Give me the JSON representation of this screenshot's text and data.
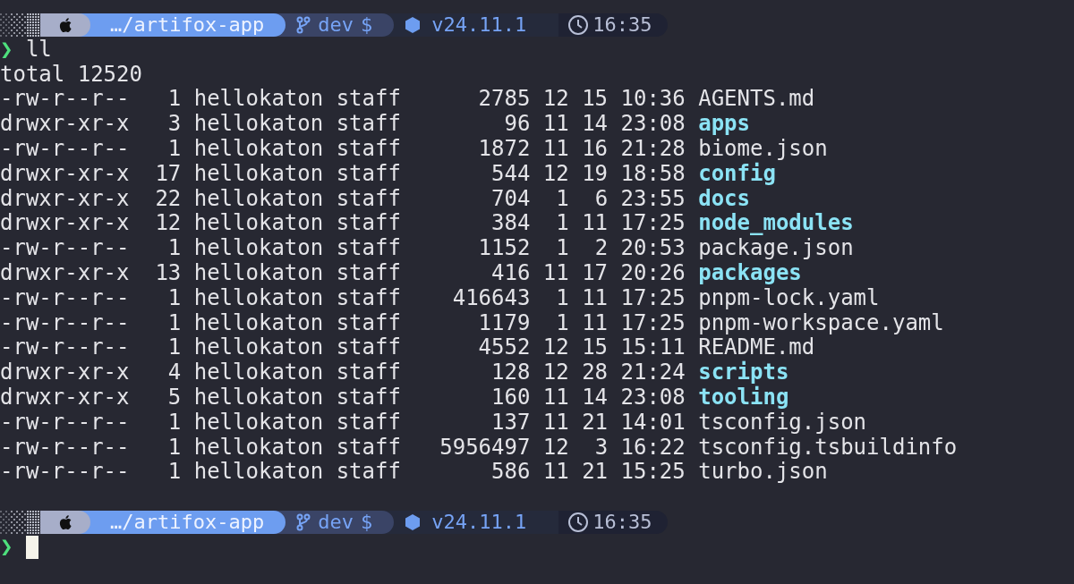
{
  "blocks": [
    {
      "prompt": {
        "path": "…/artifox-app",
        "branch": "dev",
        "git_status": "$",
        "node_version": "v24.11.1",
        "time": "16:35"
      },
      "symbol": "❯",
      "command": "ll",
      "total": "total 12520",
      "entries": [
        {
          "kind": "file",
          "perms": "-rw-r--r--",
          "links": "1",
          "owner": "hellokaton",
          "group": "staff",
          "size": "2785",
          "month": "12",
          "day": "15",
          "time": "10:36",
          "name": "AGENTS.md"
        },
        {
          "kind": "dir",
          "perms": "drwxr-xr-x",
          "links": "3",
          "owner": "hellokaton",
          "group": "staff",
          "size": "96",
          "month": "11",
          "day": "14",
          "time": "23:08",
          "name": "apps"
        },
        {
          "kind": "file",
          "perms": "-rw-r--r--",
          "links": "1",
          "owner": "hellokaton",
          "group": "staff",
          "size": "1872",
          "month": "11",
          "day": "16",
          "time": "21:28",
          "name": "biome.json"
        },
        {
          "kind": "dir",
          "perms": "drwxr-xr-x",
          "links": "17",
          "owner": "hellokaton",
          "group": "staff",
          "size": "544",
          "month": "12",
          "day": "19",
          "time": "18:58",
          "name": "config"
        },
        {
          "kind": "dir",
          "perms": "drwxr-xr-x",
          "links": "22",
          "owner": "hellokaton",
          "group": "staff",
          "size": "704",
          "month": "1",
          "day": "6",
          "time": "23:55",
          "name": "docs"
        },
        {
          "kind": "dir",
          "perms": "drwxr-xr-x",
          "links": "12",
          "owner": "hellokaton",
          "group": "staff",
          "size": "384",
          "month": "1",
          "day": "11",
          "time": "17:25",
          "name": "node_modules"
        },
        {
          "kind": "file",
          "perms": "-rw-r--r--",
          "links": "1",
          "owner": "hellokaton",
          "group": "staff",
          "size": "1152",
          "month": "1",
          "day": "2",
          "time": "20:53",
          "name": "package.json"
        },
        {
          "kind": "dir",
          "perms": "drwxr-xr-x",
          "links": "13",
          "owner": "hellokaton",
          "group": "staff",
          "size": "416",
          "month": "11",
          "day": "17",
          "time": "20:26",
          "name": "packages"
        },
        {
          "kind": "file",
          "perms": "-rw-r--r--",
          "links": "1",
          "owner": "hellokaton",
          "group": "staff",
          "size": "416643",
          "month": "1",
          "day": "11",
          "time": "17:25",
          "name": "pnpm-lock.yaml"
        },
        {
          "kind": "file",
          "perms": "-rw-r--r--",
          "links": "1",
          "owner": "hellokaton",
          "group": "staff",
          "size": "1179",
          "month": "1",
          "day": "11",
          "time": "17:25",
          "name": "pnpm-workspace.yaml"
        },
        {
          "kind": "file",
          "perms": "-rw-r--r--",
          "links": "1",
          "owner": "hellokaton",
          "group": "staff",
          "size": "4552",
          "month": "12",
          "day": "15",
          "time": "15:11",
          "name": "README.md"
        },
        {
          "kind": "dir",
          "perms": "drwxr-xr-x",
          "links": "4",
          "owner": "hellokaton",
          "group": "staff",
          "size": "128",
          "month": "12",
          "day": "28",
          "time": "21:24",
          "name": "scripts"
        },
        {
          "kind": "dir",
          "perms": "drwxr-xr-x",
          "links": "5",
          "owner": "hellokaton",
          "group": "staff",
          "size": "160",
          "month": "11",
          "day": "14",
          "time": "23:08",
          "name": "tooling"
        },
        {
          "kind": "file",
          "perms": "-rw-r--r--",
          "links": "1",
          "owner": "hellokaton",
          "group": "staff",
          "size": "137",
          "month": "11",
          "day": "21",
          "time": "14:01",
          "name": "tsconfig.json"
        },
        {
          "kind": "file",
          "perms": "-rw-r--r--",
          "links": "1",
          "owner": "hellokaton",
          "group": "staff",
          "size": "5956497",
          "month": "12",
          "day": "3",
          "time": "16:22",
          "name": "tsconfig.tsbuildinfo"
        },
        {
          "kind": "file",
          "perms": "-rw-r--r--",
          "links": "1",
          "owner": "hellokaton",
          "group": "staff",
          "size": "586",
          "month": "11",
          "day": "21",
          "time": "15:25",
          "name": "turbo.json"
        }
      ]
    },
    {
      "prompt": {
        "path": "…/artifox-app",
        "branch": "dev",
        "git_status": "$",
        "node_version": "v24.11.1",
        "time": "16:35"
      },
      "symbol": "❯",
      "cursor": true
    }
  ]
}
